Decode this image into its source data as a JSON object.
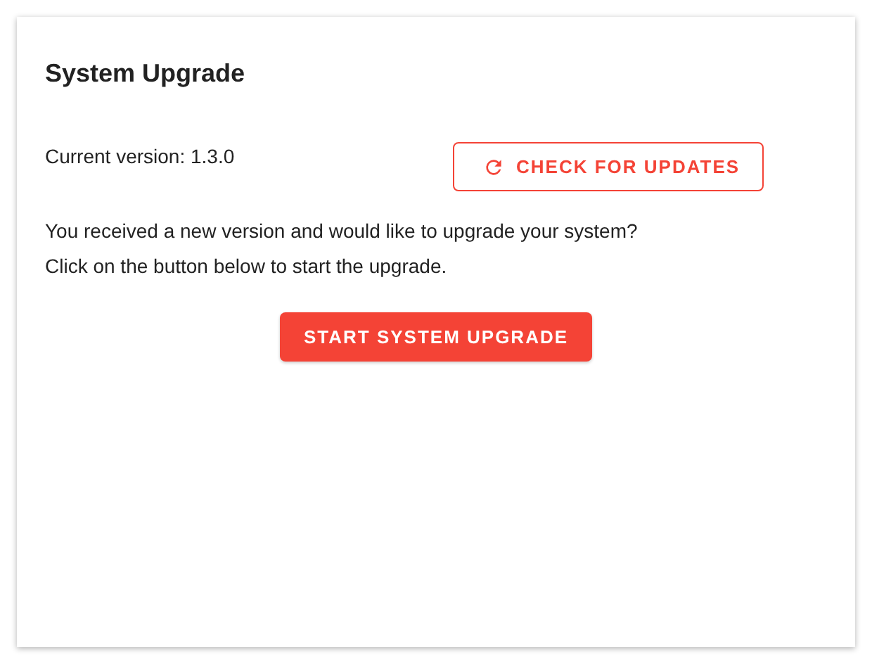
{
  "card": {
    "title": "System Upgrade",
    "current_version": "Current version: 1.3.0",
    "check_button": {
      "label": "CHECK FOR UPDATES"
    },
    "message_lines": [
      "You received a new version and would like to upgrade your system?",
      "Click on the button below to start the upgrade."
    ],
    "upgrade_button": {
      "label": "START SYSTEM UPGRADE"
    }
  }
}
